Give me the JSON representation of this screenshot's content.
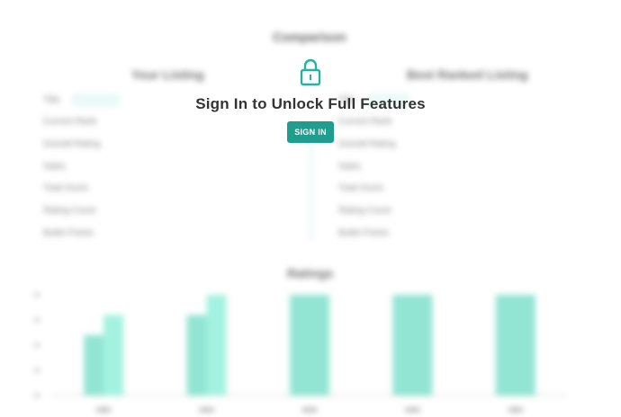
{
  "background": {
    "title": "Comparison",
    "subtitle": "",
    "left_column": {
      "heading": "Your Listing",
      "rows": [
        {
          "label": "Title",
          "value": ""
        },
        {
          "label": "Current Rank",
          "value": ""
        },
        {
          "label": "Overall Rating",
          "value": ""
        },
        {
          "label": "Sales",
          "value": ""
        },
        {
          "label": "Total Score",
          "value": ""
        },
        {
          "label": "Rating Count",
          "value": ""
        },
        {
          "label": "Bullet Points",
          "value": ""
        }
      ]
    },
    "right_column": {
      "heading": "Best Ranked Listing",
      "rows": [
        {
          "label": "Title",
          "value": ""
        },
        {
          "label": "Current Rank",
          "value": ""
        },
        {
          "label": "Overall Rating",
          "value": ""
        },
        {
          "label": "Sales",
          "value": ""
        },
        {
          "label": "Total Score",
          "value": ""
        },
        {
          "label": "Rating Count",
          "value": ""
        },
        {
          "label": "Bullet Points",
          "value": ""
        }
      ]
    },
    "chart_title": "Ratings"
  },
  "chart_data": {
    "type": "bar",
    "title": "Ratings",
    "categories": [
      "",
      "",
      "",
      "",
      ""
    ],
    "series": [
      {
        "values": [
          3,
          4,
          5,
          5,
          5
        ]
      },
      {
        "values": [
          4,
          5,
          5,
          5,
          5
        ]
      }
    ],
    "ylim": [
      0,
      5
    ],
    "grid": false
  },
  "overlay": {
    "lock_icon": "lock-icon",
    "title": "Sign In to Unlock Full Features",
    "button_label": "SIGN IN",
    "accent_color": "#1f9d8f"
  }
}
